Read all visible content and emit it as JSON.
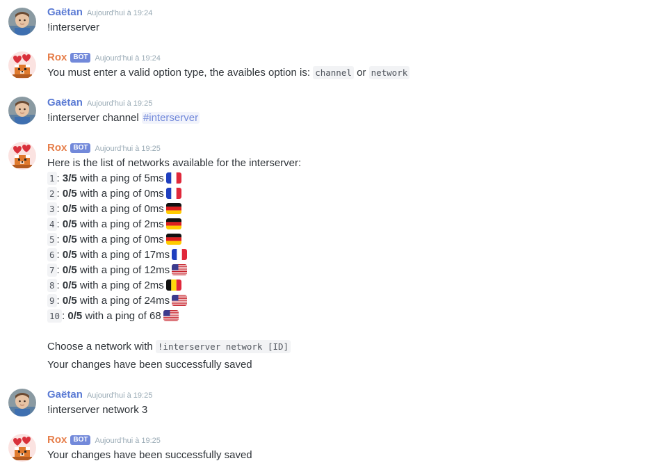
{
  "colors": {
    "user_name": "#5b7bd4",
    "bot_name": "#e67e4a",
    "badge": "#7289da",
    "mention": "#7289da"
  },
  "messages": [
    {
      "author": "Gaëtan",
      "time": "Aujourd'hui à 19:24",
      "text": "!interserver"
    },
    {
      "author": "Rox",
      "badge": "BOT",
      "time": "Aujourd'hui à 19:24",
      "text_prefix": "You must enter a valid option type, the avaibles option is:",
      "code1": "channel",
      "or": "or",
      "code2": "network"
    },
    {
      "author": "Gaëtan",
      "time": "Aujourd'hui à 19:25",
      "text": "!interserver channel",
      "mention": "#interserver"
    },
    {
      "author": "Rox",
      "badge": "BOT",
      "time": "Aujourd'hui à 19:25",
      "intro": "Here is the list of networks available for the interserver:",
      "networks": [
        {
          "id": "1",
          "sep": ":",
          "count": "3/5",
          "ping": "with a ping of 5ms",
          "flag": "fr"
        },
        {
          "id": "2",
          "sep": ":",
          "count": "0/5",
          "ping": "with a ping of 0ms",
          "flag": "fr"
        },
        {
          "id": "3",
          "sep": ":",
          "count": "0/5",
          "ping": "with a ping of 0ms",
          "flag": "de"
        },
        {
          "id": "4",
          "sep": ":",
          "count": "0/5",
          "ping": "with a ping of 2ms",
          "flag": "de"
        },
        {
          "id": "5",
          "sep": ":",
          "count": "0/5",
          "ping": "with a ping of 0ms",
          "flag": "de"
        },
        {
          "id": "6",
          "sep": ":",
          "count": "0/5",
          "ping": "with a ping of 17ms",
          "flag": "fr"
        },
        {
          "id": "7",
          "sep": ":",
          "count": "0/5",
          "ping": "with a ping of 12ms",
          "flag": "us"
        },
        {
          "id": "8",
          "sep": ":",
          "count": "0/5",
          "ping": "with a ping of 2ms",
          "flag": "be"
        },
        {
          "id": "9",
          "sep": ":",
          "count": "0/5",
          "ping": "with a ping of 24ms",
          "flag": "us"
        },
        {
          "id": "10",
          "sep": ":",
          "count": "0/5",
          "ping": "with a ping of 68",
          "flag": "us"
        }
      ],
      "choose_prefix": "Choose a network with",
      "choose_code": "!interserver network [ID]",
      "saved": "Your changes have been successfully saved"
    },
    {
      "author": "Gaëtan",
      "time": "Aujourd'hui à 19:25",
      "text": "!interserver network 3"
    },
    {
      "author": "Rox",
      "badge": "BOT",
      "time": "Aujourd'hui à 19:25",
      "text": "Your changes have been successfully saved"
    }
  ]
}
